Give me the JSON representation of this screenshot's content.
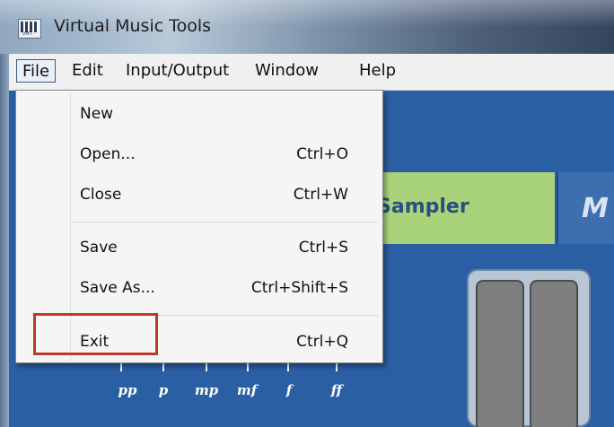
{
  "window": {
    "title": "Virtual Music Tools",
    "icon": "vmt-piano-icon",
    "icon_sublabel": "VMT"
  },
  "menubar": {
    "items": [
      {
        "label": "File",
        "active": true
      },
      {
        "label": "Edit"
      },
      {
        "label": "Input/Output"
      },
      {
        "label": "Window"
      },
      {
        "label": "Help"
      }
    ]
  },
  "file_menu": {
    "items": [
      {
        "label": "New",
        "shortcut": ""
      },
      {
        "label": "Open...",
        "shortcut": "Ctrl+O"
      },
      {
        "label": "Close",
        "shortcut": "Ctrl+W"
      },
      {
        "label": "Save",
        "shortcut": "Ctrl+S"
      },
      {
        "label": "Save As...",
        "shortcut": "Ctrl+Shift+S"
      },
      {
        "label": "Exit",
        "shortcut": "Ctrl+Q"
      }
    ],
    "highlighted_item": "Exit",
    "highlight_color": "#c0392b"
  },
  "app": {
    "sampler_label": "Sampler",
    "logo_glyph": "M",
    "dynamics": [
      "pp",
      "p",
      "mp",
      "mf",
      "f",
      "ff"
    ]
  },
  "colors": {
    "app_background": "#2b5fa4",
    "sampler_band": "#a9d37a",
    "menu_background": "#f5f5f5"
  }
}
